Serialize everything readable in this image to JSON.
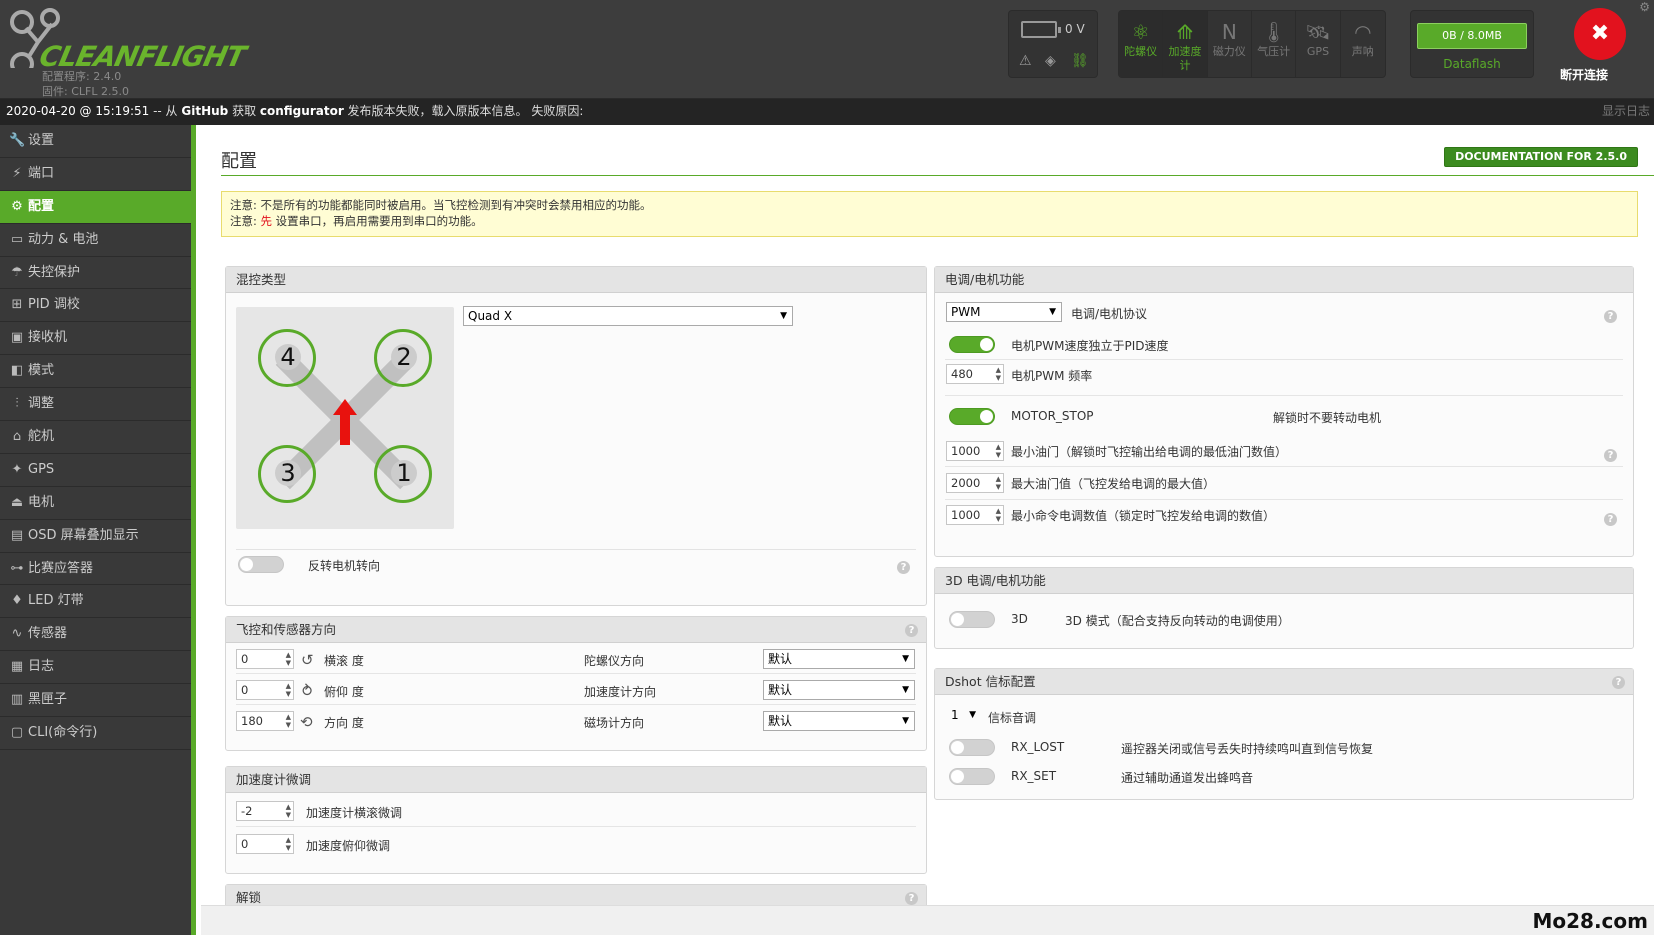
{
  "header": {
    "logo_text": "CLEANFLIGHT",
    "configurator_version": "配置程序: 2.4.0",
    "firmware_version": "固件: CLFL 2.5.0",
    "battery_voltage": "0 V",
    "sensors": [
      {
        "label": "陀螺仪",
        "icon": "gyro-icon",
        "active": true
      },
      {
        "label": "加速度计",
        "icon": "accel-icon",
        "active": true
      },
      {
        "label": "磁力仪",
        "icon": "mag-icon",
        "active": false
      },
      {
        "label": "气压计",
        "icon": "baro-icon",
        "active": false
      },
      {
        "label": "GPS",
        "icon": "gps-icon",
        "active": false
      },
      {
        "label": "声呐",
        "icon": "sonar-icon",
        "active": false
      }
    ],
    "dataflash_usage": "0B / 8.0MB",
    "dataflash_label": "Dataflash",
    "disconnect_label": "断开连接"
  },
  "logbar": {
    "date": "2020-04-20 @ 15:19:51",
    "sep": " -- 从 ",
    "github": "GitHub",
    "text_a": " 获取 ",
    "configurator": "configurator",
    "text_b": " 发布版本失败，载入原版本信息。 失败原因:",
    "show_log": "显示日志"
  },
  "sidebar": {
    "items": [
      {
        "label": "设置",
        "icon": "wrench-icon"
      },
      {
        "label": "端口",
        "icon": "plug-icon"
      },
      {
        "label": "配置",
        "icon": "gear-icon"
      },
      {
        "label": "动力 & 电池",
        "icon": "battery-icon"
      },
      {
        "label": "失控保护",
        "icon": "parachute-icon"
      },
      {
        "label": "PID 调校",
        "icon": "sitemap-icon"
      },
      {
        "label": "接收机",
        "icon": "receiver-icon"
      },
      {
        "label": "模式",
        "icon": "toggle-icon"
      },
      {
        "label": "调整",
        "icon": "sliders-icon"
      },
      {
        "label": "舵机",
        "icon": "servo-icon"
      },
      {
        "label": "GPS",
        "icon": "satellite-icon"
      },
      {
        "label": "电机",
        "icon": "motor-icon"
      },
      {
        "label": "OSD 屏幕叠加显示",
        "icon": "osd-icon"
      },
      {
        "label": "比赛应答器",
        "icon": "transponder-icon"
      },
      {
        "label": "LED 灯带",
        "icon": "led-icon"
      },
      {
        "label": "传感器",
        "icon": "pulse-icon"
      },
      {
        "label": "日志",
        "icon": "log-icon"
      },
      {
        "label": "黑匣子",
        "icon": "blackbox-icon"
      },
      {
        "label": "CLI(命令行)",
        "icon": "terminal-icon"
      }
    ],
    "active_index": 2
  },
  "page": {
    "title": "配置",
    "doc_button": "DOCUMENTATION FOR 2.5.0",
    "note1_prefix": "注意:",
    "note1_text": " 不是所有的功能都能同时被启用。当飞控检测到有冲突时会禁用相应的功能。",
    "note2_prefix": "注意:",
    "note2_red": " 先",
    "note2_text": " 设置串口，再启用需要用到串口的功能。"
  },
  "mixer": {
    "title": "混控类型",
    "selected": "Quad X",
    "motors": [
      "4",
      "2",
      "3",
      "1"
    ],
    "reverse_label": "反转电机转向",
    "reverse_on": false
  },
  "alignment": {
    "title": "飞控和传感器方向",
    "rows": [
      {
        "value": "0",
        "axis": "横滚 度",
        "sensor": "陀螺仪方向",
        "option": "默认"
      },
      {
        "value": "0",
        "axis": "俯仰 度",
        "sensor": "加速度计方向",
        "option": "默认"
      },
      {
        "value": "180",
        "axis": "方向 度",
        "sensor": "磁场计方向",
        "option": "默认"
      }
    ]
  },
  "accel_trim": {
    "title": "加速度计微调",
    "rows": [
      {
        "value": "-2",
        "label": "加速度计横滚微调"
      },
      {
        "value": "0",
        "label": "加速度俯仰微调"
      }
    ]
  },
  "arming": {
    "title": "解锁"
  },
  "esc": {
    "title": "电调/电机功能",
    "protocol": "PWM",
    "protocol_label": "电调/电机协议",
    "pwm_independent_label": "电机PWM速度独立于PID速度",
    "pwm_independent_on": true,
    "pwm_freq": "480",
    "pwm_freq_label": "电机PWM 频率",
    "motor_stop_label": "MOTOR_STOP",
    "motor_stop_desc": "解锁时不要转动电机",
    "motor_stop_on": true,
    "min_throttle": "1000",
    "min_throttle_label": "最小油门（解锁时飞控输出给电调的最低油门数值）",
    "max_throttle": "2000",
    "max_throttle_label": "最大油门值（飞控发给电调的最大值）",
    "min_command": "1000",
    "min_command_label": "最小命令电调数值（锁定时飞控发给电调的数值）"
  },
  "esc3d": {
    "title": "3D 电调/电机功能",
    "label": "3D",
    "desc": "3D 模式（配合支持反向转动的电调使用）",
    "on": false
  },
  "dshot": {
    "title": "Dshot 信标配置",
    "tone": "1",
    "tone_label": "信标音调",
    "rx_lost": "RX_LOST",
    "rx_lost_desc": "遥控器关闭或信号丢失时持续鸣叫直到信号恢复",
    "rx_set": "RX_SET",
    "rx_set_desc": "通过辅助通道发出蜂鸣音"
  },
  "watermark": "Mo28.com",
  "colors": {
    "accent": "#59aa29",
    "header": "#3d3d3d",
    "sidebar": "#393939",
    "danger": "#e2121e"
  }
}
